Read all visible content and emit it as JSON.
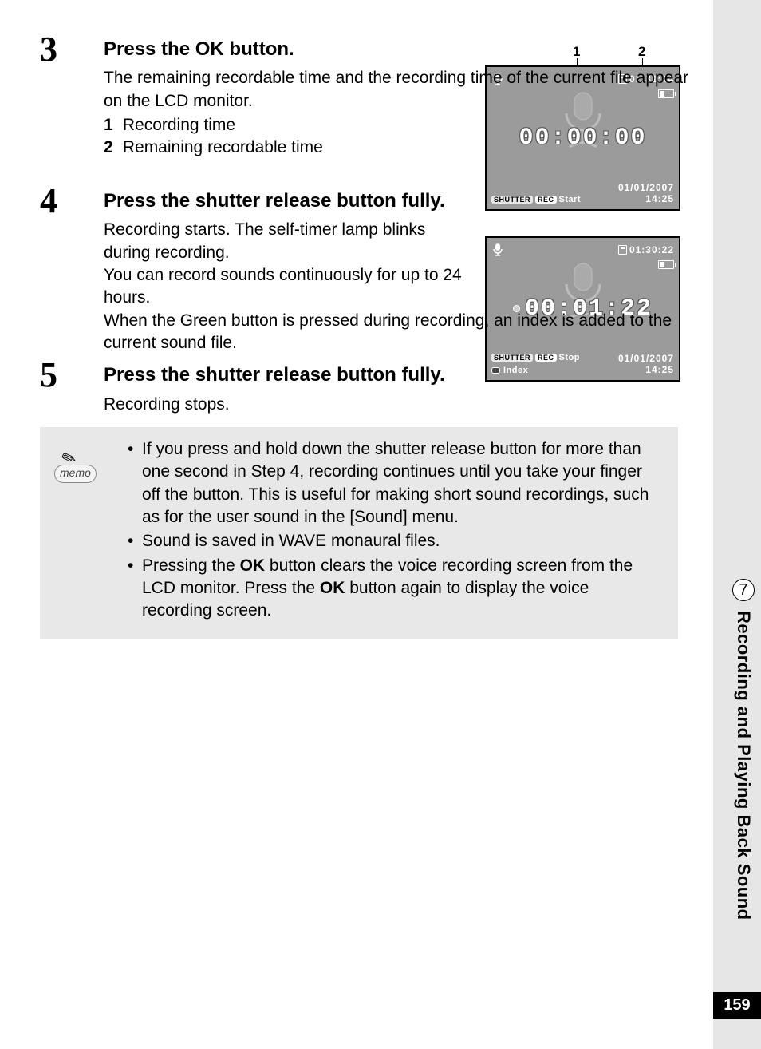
{
  "chapter": {
    "number": "7",
    "title": "Recording and Playing Back Sound"
  },
  "pageNumber": "159",
  "callouts": {
    "c1": "1",
    "c2": "2"
  },
  "steps": {
    "s3": {
      "num": "3",
      "title_pre": "Press the ",
      "title_ok": "OK",
      "title_post": " button.",
      "text": "The remaining recordable time and the recording time of the current file appear on the LCD monitor.",
      "sub1n": "1",
      "sub1t": "Recording time",
      "sub2n": "2",
      "sub2t": "Remaining recordable time"
    },
    "s4": {
      "num": "4",
      "title": "Press the shutter release button fully.",
      "p1": "Recording starts. The self-timer lamp blinks during recording.",
      "p2": "You can record sounds continuously for up to 24 hours.",
      "p3": "When the Green button is pressed during recording, an index is added to the current sound file."
    },
    "s5": {
      "num": "5",
      "title": "Press the shutter release button fully.",
      "p1": "Recording stops."
    }
  },
  "memo": {
    "label": "memo",
    "b1": "If you press and hold down the shutter release button for more than one second in Step 4, recording continues until you take your finger off the button. This is useful for making short sound recordings, such as for the user sound in the [Sound] menu.",
    "b2": "Sound is saved in WAVE monaural files.",
    "b3_pre": "Pressing the ",
    "b3_ok1": "OK",
    "b3_mid": " button clears the voice recording screen from the LCD monitor. Press the ",
    "b3_ok2": "OK",
    "b3_post": " button again to display the voice recording screen."
  },
  "lcd1": {
    "remaining": "01:31:44",
    "main": "00:00:00",
    "shutter": "SHUTTER",
    "rec": "REC",
    "action": "Start",
    "date": "01/01/2007",
    "time": "14:25"
  },
  "lcd2": {
    "remaining": "01:30:22",
    "main": "00:01:22",
    "shutter": "SHUTTER",
    "rec": "REC",
    "action": "Stop",
    "index": "Index",
    "date": "01/01/2007",
    "time": "14:25"
  }
}
